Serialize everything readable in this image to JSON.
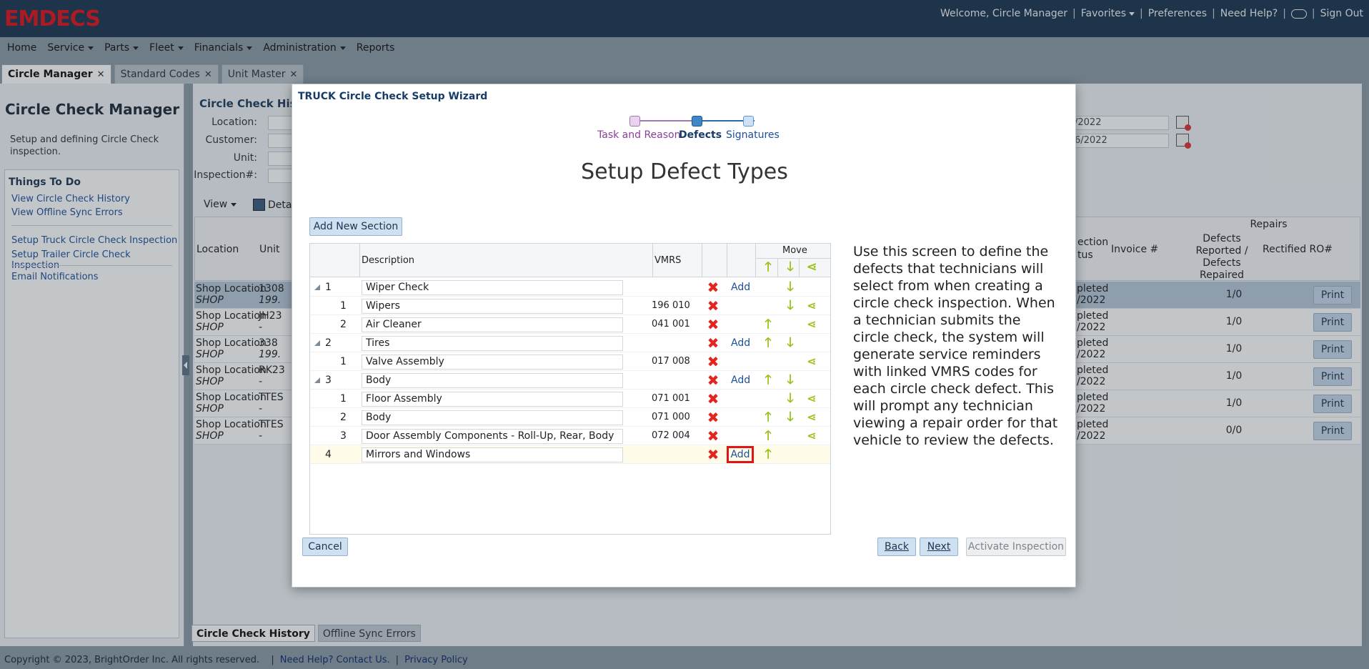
{
  "header": {
    "logo": "EMDECS",
    "welcome": "Welcome, Circle Manager",
    "links": [
      "Favorites",
      "Preferences",
      "Need Help?",
      "Sign Out"
    ]
  },
  "menu": [
    "Home",
    "Service",
    "Parts",
    "Fleet",
    "Financials",
    "Administration",
    "Reports"
  ],
  "tabs": [
    "Circle Manager",
    "Standard Codes",
    "Unit Master"
  ],
  "left_panel": {
    "title": "Circle Check Manager",
    "description": "Setup and defining Circle Check inspection.",
    "todo_title": "Things To Do",
    "links": [
      "View Circle Check History",
      "View Offline Sync Errors",
      "Setup Truck Circle Check Inspection",
      "Setup Trailer Circle Check Inspection",
      "Email Notifications"
    ]
  },
  "background": {
    "title": "Circle Check Histo",
    "labels": [
      "Location:",
      "Customer:",
      "Unit:",
      "Inspection#:"
    ],
    "view_label": "View",
    "detail_label": "Detai",
    "date_from": "/2022",
    "date_to": "6/2022",
    "headers": {
      "location": "Location",
      "unit": "Unit",
      "status_line1": "ection",
      "status_line2": "tus",
      "invoice": "Invoice #",
      "repairs": "Repairs",
      "defects": "Defects Reported / Defects Repaired",
      "rectified": "Rectified RO#"
    },
    "rows": [
      {
        "loc": "Shop Location",
        "sub": "SHOP",
        "unit1": "1308",
        "unit2": "199.",
        "stat1": "pleted",
        "stat2": "/2022",
        "rep": "1/0",
        "print": "Print"
      },
      {
        "loc": "Shop Location",
        "sub": "SHOP",
        "unit1": "JH23",
        "unit2": "-",
        "stat1": "pleted",
        "stat2": "/2022",
        "rep": "1/0",
        "print": "Print"
      },
      {
        "loc": "Shop Location",
        "sub": "SHOP",
        "unit1": "338",
        "unit2": "199.",
        "stat1": "pleted",
        "stat2": "/2022",
        "rep": "1/0",
        "print": "Print"
      },
      {
        "loc": "Shop Location",
        "sub": "SHOP",
        "unit1": "RK23",
        "unit2": "-",
        "stat1": "pleted",
        "stat2": "/2022",
        "rep": "1/0",
        "print": "Print"
      },
      {
        "loc": "Shop Location",
        "sub": "SHOP",
        "unit1": "TTES",
        "unit2": "-",
        "stat1": "pleted",
        "stat2": "/2022",
        "rep": "1/0",
        "print": "Print"
      },
      {
        "loc": "Shop Location",
        "sub": "SHOP",
        "unit1": "TTES",
        "unit2": "-",
        "stat1": "pleted",
        "stat2": "/2022",
        "rep": "0/0",
        "print": "Print"
      }
    ],
    "bottom_tabs": [
      "Circle Check History",
      "Offline Sync Errors"
    ]
  },
  "footer": {
    "copyright": "Copyright © 2023, BrightOrder Inc. All rights reserved.",
    "help": "Need Help? Contact Us.",
    "privacy": "Privacy Policy"
  },
  "modal": {
    "title": "TRUCK Circle Check Setup Wizard",
    "steps": [
      "Task and Reason",
      "Defects",
      "Signatures"
    ],
    "heading": "Setup Defect Types",
    "add_section": "Add New Section",
    "columns": {
      "description": "Description",
      "vmrs": "VMRS",
      "move": "Move"
    },
    "add_label": "Add",
    "rows": [
      {
        "type": "section",
        "num": "1",
        "desc": "Wiper Check",
        "vmrs": "",
        "add": true,
        "up": false,
        "down": true,
        "move": false
      },
      {
        "type": "item",
        "num": "1",
        "desc": "Wipers",
        "vmrs": "196 010",
        "add": false,
        "up": false,
        "down": true,
        "move": true
      },
      {
        "type": "item",
        "num": "2",
        "desc": "Air Cleaner",
        "vmrs": "041 001",
        "add": false,
        "up": true,
        "down": false,
        "move": true
      },
      {
        "type": "section",
        "num": "2",
        "desc": "Tires",
        "vmrs": "",
        "add": true,
        "up": true,
        "down": true,
        "move": false
      },
      {
        "type": "item",
        "num": "1",
        "desc": "Valve Assembly",
        "vmrs": "017 008",
        "add": false,
        "up": false,
        "down": false,
        "move": true
      },
      {
        "type": "section",
        "num": "3",
        "desc": "Body",
        "vmrs": "",
        "add": true,
        "up": true,
        "down": true,
        "move": false
      },
      {
        "type": "item",
        "num": "1",
        "desc": "Floor Assembly",
        "vmrs": "071 001",
        "add": false,
        "up": false,
        "down": true,
        "move": true
      },
      {
        "type": "item",
        "num": "2",
        "desc": "Body",
        "vmrs": "071 000",
        "add": false,
        "up": true,
        "down": true,
        "move": true
      },
      {
        "type": "item",
        "num": "3",
        "desc": "Door Assembly Components - Roll-Up, Rear, Body",
        "vmrs": "072 004",
        "add": false,
        "up": true,
        "down": false,
        "move": true
      },
      {
        "type": "new",
        "num": "4",
        "desc": "Mirrors and Windows",
        "vmrs": "",
        "add": true,
        "up": true,
        "down": false,
        "move": false
      }
    ],
    "info": "Use this screen to define the defects that technicians will select from when creating a circle check inspection. When a technician submits the circle check, the system will generate service reminders with linked VMRS codes for each circle check defect. This will prompt any technician viewing a repair order for that vehicle to review the defects.",
    "buttons": {
      "cancel": "Cancel",
      "back": "Back",
      "next": "Next",
      "activate": "Activate Inspection"
    }
  }
}
